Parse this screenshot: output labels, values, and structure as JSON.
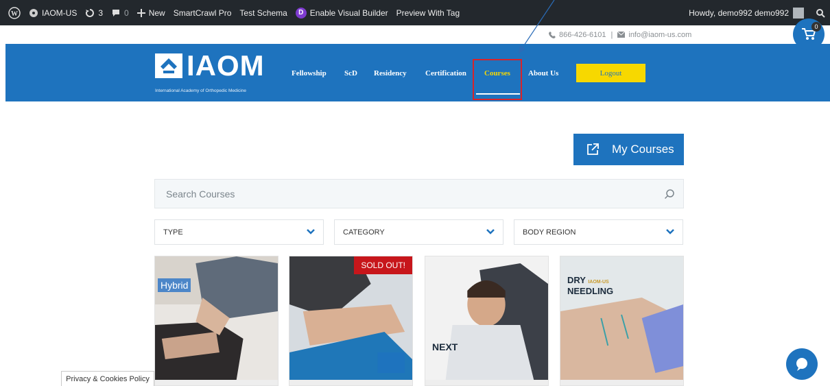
{
  "admin_bar": {
    "site_name": "IAOM-US",
    "updates_count": "3",
    "comments_count": "0",
    "new_label": "New",
    "items": [
      "SmartCrawl Pro",
      "Test Schema"
    ],
    "divi_letter": "D",
    "visual_builder": "Enable Visual Builder",
    "preview": "Preview With Tag",
    "howdy": "Howdy, demo992 demo992"
  },
  "contact": {
    "phone": "866-426-6101",
    "separator": "|",
    "email": "info@iaom-us.com"
  },
  "cart": {
    "count": "0"
  },
  "logo": {
    "text": "IAOM",
    "tagline": "International Academy of Orthopedic Medicine"
  },
  "nav": {
    "items": [
      "Fellowship",
      "ScD",
      "Residency",
      "Certification",
      "Courses",
      "About Us"
    ],
    "active": "Courses",
    "logout": "Logout"
  },
  "content": {
    "my_courses": "My Courses",
    "search_placeholder": "Search Courses",
    "filters": [
      "TYPE",
      "CATEGORY",
      "BODY REGION"
    ]
  },
  "cards": [
    {
      "badge": "Hybrid"
    },
    {
      "badge": "SOLD OUT!"
    },
    {
      "badge": "NEXT"
    },
    {
      "badge_line1": "DRY",
      "badge_small": "IAOM-US",
      "badge_line2": "NEEDLING"
    }
  ],
  "footer": {
    "privacy": "Privacy & Cookies Policy"
  },
  "colors": {
    "brand_blue": "#1e73be",
    "accent_yellow": "#f7d800",
    "highlight_red": "#d8232a",
    "sold_red": "#c7161b"
  }
}
